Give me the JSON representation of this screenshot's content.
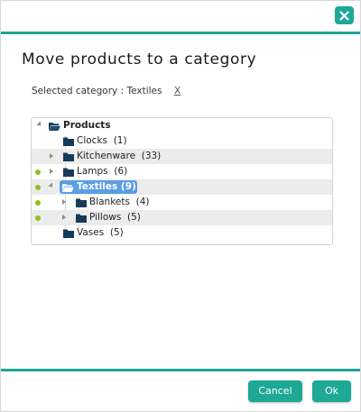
{
  "dialog": {
    "title": "Move products to a category",
    "selected_label": "Selected category : Textiles",
    "clear_label": "X",
    "accent_color": "#1ea896",
    "selection_color": "#5b9de6",
    "marker_color": "#8cc21e"
  },
  "tree": {
    "root": "Products",
    "items": [
      {
        "label": "Clocks",
        "count": "(1)"
      },
      {
        "label": "Kitchenware",
        "count": "(33)"
      },
      {
        "label": "Lamps",
        "count": "(6)"
      },
      {
        "label": "Textiles",
        "count": "(9)"
      },
      {
        "label": "Blankets",
        "count": "(4)"
      },
      {
        "label": "Pillows",
        "count": "(5)"
      },
      {
        "label": "Vases",
        "count": "(5)"
      }
    ]
  },
  "footer": {
    "cancel_label": "Cancel",
    "ok_label": "Ok"
  }
}
